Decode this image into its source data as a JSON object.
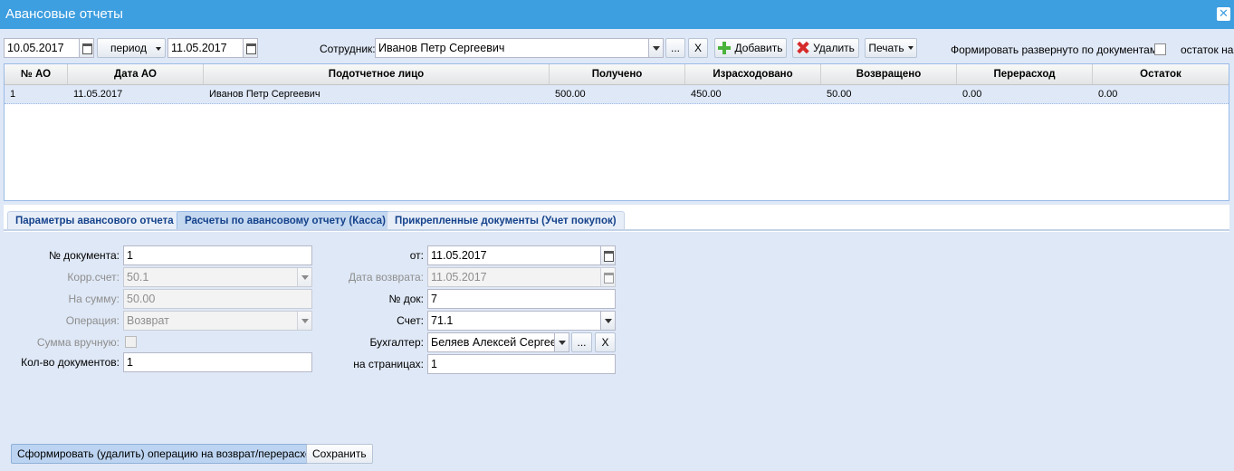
{
  "window": {
    "title": "Авансовые отчеты",
    "close_label": "✕"
  },
  "toolbar": {
    "date_from": "10.05.2017",
    "period_label": "период",
    "date_to": "11.05.2017",
    "employee_label": "Сотрудник:",
    "employee_value": "Иванов Петр Сергеевич",
    "dots_label": "...",
    "clear_label": "X",
    "add_label": "Добавить",
    "delete_label": "Удалить",
    "print_label": "Печать",
    "expand_label": "Формировать развернуто по документам:",
    "remainder_label": "остаток на"
  },
  "grid": {
    "columns": [
      "№ АО",
      "Дата АО",
      "Подотчетное лицо",
      "Получено",
      "Израсходовано",
      "Возвращено",
      "Перерасход",
      "Остаток"
    ],
    "rows": [
      [
        "1",
        "11.05.2017",
        "Иванов Петр Сергеевич",
        "500.00",
        "450.00",
        "50.00",
        "0.00",
        "0.00"
      ]
    ]
  },
  "tabs": [
    {
      "label": "Параметры авансового отчета"
    },
    {
      "label": "Расчеты по авансовому отчету (Касса)"
    },
    {
      "label": "Прикрепленные документы (Учет покупок)"
    }
  ],
  "form": {
    "doc_no_label": "№ документа:",
    "doc_no_value": "1",
    "corr_label": "Корр.счет:",
    "corr_value": "50.1",
    "sum_label": "На сумму:",
    "sum_value": "50.00",
    "operation_label": "Операция:",
    "operation_value": "Возврат",
    "manual_label": "Сумма вручную:",
    "docs_count_label": "Кол-во документов:",
    "docs_count_value": "1",
    "from_label": "от:",
    "from_value": "11.05.2017",
    "return_date_label": "Дата возврата:",
    "return_date_value": "11.05.2017",
    "doc_num_label": "№ док:",
    "doc_num_value": "7",
    "account_label": "Счет:",
    "account_value": "71.1",
    "accountant_label": "Бухгалтер:",
    "accountant_value": "Беляев Алексей Сергеевич",
    "pages_label": "на страницах:",
    "pages_value": "1"
  },
  "actions": {
    "form_operation_label": "Сформировать (удалить) операцию на возврат/перерасход",
    "save_label": "Сохранить"
  }
}
